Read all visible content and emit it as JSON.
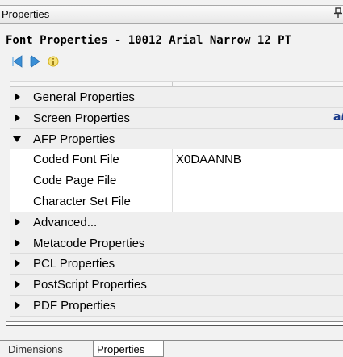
{
  "window": {
    "title": "Properties",
    "pin_glyph": "ᵩ"
  },
  "header": {
    "title": "Font Properties - 10012  Arial Narrow 12 PT"
  },
  "toolbar": {
    "back_icon": "arrow-left-icon",
    "forward_icon": "arrow-right-icon",
    "info_icon": "info-icon"
  },
  "grid": {
    "rows": [
      {
        "type": "category",
        "label": "General Properties",
        "expanded": false
      },
      {
        "type": "category",
        "label": "Screen Properties",
        "expanded": false,
        "extra_icon": "aℓ"
      },
      {
        "type": "category",
        "label": "AFP Properties",
        "expanded": true
      },
      {
        "type": "property",
        "label": "Coded Font File",
        "value": "X0DAANNB"
      },
      {
        "type": "property",
        "label": "Code Page File",
        "value": ""
      },
      {
        "type": "property",
        "label": "Character Set File",
        "value": ""
      },
      {
        "type": "subcategory",
        "label": "Advanced...",
        "expanded": false
      },
      {
        "type": "category",
        "label": "Metacode Properties",
        "expanded": false
      },
      {
        "type": "category",
        "label": "PCL Properties",
        "expanded": false
      },
      {
        "type": "category",
        "label": "PostScript Properties",
        "expanded": false
      },
      {
        "type": "category",
        "label": "PDF Properties",
        "expanded": false
      }
    ]
  },
  "tabs": [
    {
      "label": "Dimensions",
      "active": false
    },
    {
      "label": "Properties",
      "active": true
    }
  ],
  "colors": {
    "nav_arrow": "#3a8fd6",
    "info": "#e4c12a"
  }
}
